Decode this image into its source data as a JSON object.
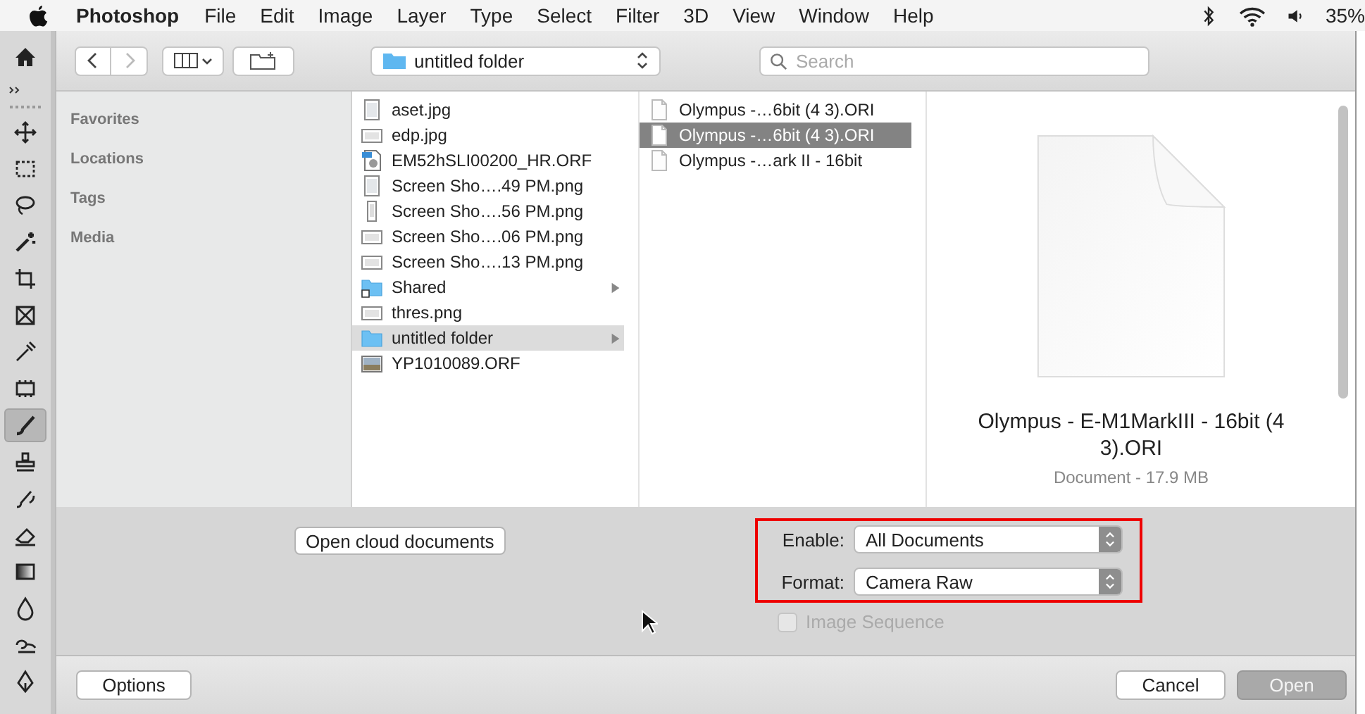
{
  "menu_bar": {
    "app": "Photoshop",
    "menus": [
      "File",
      "Edit",
      "Image",
      "Layer",
      "Type",
      "Select",
      "Filter",
      "3D",
      "View",
      "Window",
      "Help"
    ],
    "battery": "35%"
  },
  "tools": [
    {
      "kind": "move",
      "selected": false
    },
    {
      "kind": "marquee",
      "selected": false
    },
    {
      "kind": "lasso",
      "selected": false
    },
    {
      "kind": "wand",
      "selected": false
    },
    {
      "kind": "crop",
      "selected": false
    },
    {
      "kind": "frame",
      "selected": false
    },
    {
      "kind": "eyedropper",
      "selected": false
    },
    {
      "kind": "patch",
      "selected": false
    },
    {
      "kind": "brush",
      "selected": true
    },
    {
      "kind": "stamp",
      "selected": false
    },
    {
      "kind": "history",
      "selected": false
    },
    {
      "kind": "eraser",
      "selected": false
    },
    {
      "kind": "gradient",
      "selected": false
    },
    {
      "kind": "blur",
      "selected": false
    },
    {
      "kind": "dodge",
      "selected": false
    },
    {
      "kind": "pen",
      "selected": false
    }
  ],
  "toolbar": {
    "nav": [
      {
        "kind": "back",
        "disabled": false
      },
      {
        "kind": "forward",
        "disabled": true
      }
    ],
    "location": "untitled folder",
    "search": {
      "placeholder": "Search"
    }
  },
  "sidebar": [
    "Favorites",
    "Locations",
    "Tags",
    "Media"
  ],
  "columns": [
    {
      "focused": false,
      "items": [
        {
          "name": "aset.jpg",
          "kind": "portrait",
          "selected": false
        },
        {
          "name": "edp.jpg",
          "kind": "landscape",
          "selected": false
        },
        {
          "name": "EM52hSLI00200_HR.ORF",
          "kind": "raw",
          "selected": false
        },
        {
          "name": "Screen Sho….49 PM.png",
          "kind": "portrait",
          "selected": false
        },
        {
          "name": "Screen Sho….56 PM.png",
          "kind": "tall",
          "selected": false
        },
        {
          "name": "Screen Sho….06 PM.png",
          "kind": "landscape",
          "selected": false
        },
        {
          "name": "Screen Sho….13 PM.png",
          "kind": "landscape",
          "selected": false
        },
        {
          "name": "Shared",
          "kind": "alias",
          "selected": false
        },
        {
          "name": "thres.png",
          "kind": "landscape",
          "selected": false
        },
        {
          "name": "untitled folder",
          "kind": "folder",
          "selected": true
        },
        {
          "name": "YP1010089.ORF",
          "kind": "photo",
          "selected": false
        }
      ]
    },
    {
      "focused": true,
      "items": [
        {
          "name": "Olympus -…6bit (4 3).ORI",
          "kind": "document",
          "selected": false
        },
        {
          "name": "Olympus -…6bit (4 3).ORI",
          "kind": "document",
          "selected": true
        },
        {
          "name": "Olympus -…ark II - 16bit",
          "kind": "document",
          "selected": false
        }
      ]
    }
  ],
  "preview": {
    "name": "Olympus - E-M1MarkIII - 16bit (4 3).ORI",
    "info": "Document - 17.9 MB"
  },
  "cloud_button": "Open cloud documents",
  "fields_highlighted": true,
  "fields": [
    {
      "label": "Enable:",
      "value": "All Documents"
    },
    {
      "label": "Format:",
      "value": "Camera Raw"
    }
  ],
  "image_sequence": {
    "label": "Image Sequence",
    "checked": false,
    "disabled": true
  },
  "buttons": [
    {
      "label": "Options",
      "kind": "plain",
      "disabled": false
    },
    {
      "label": "Cancel",
      "kind": "plain",
      "disabled": false
    },
    {
      "label": "Open",
      "kind": "default",
      "disabled": true
    }
  ]
}
